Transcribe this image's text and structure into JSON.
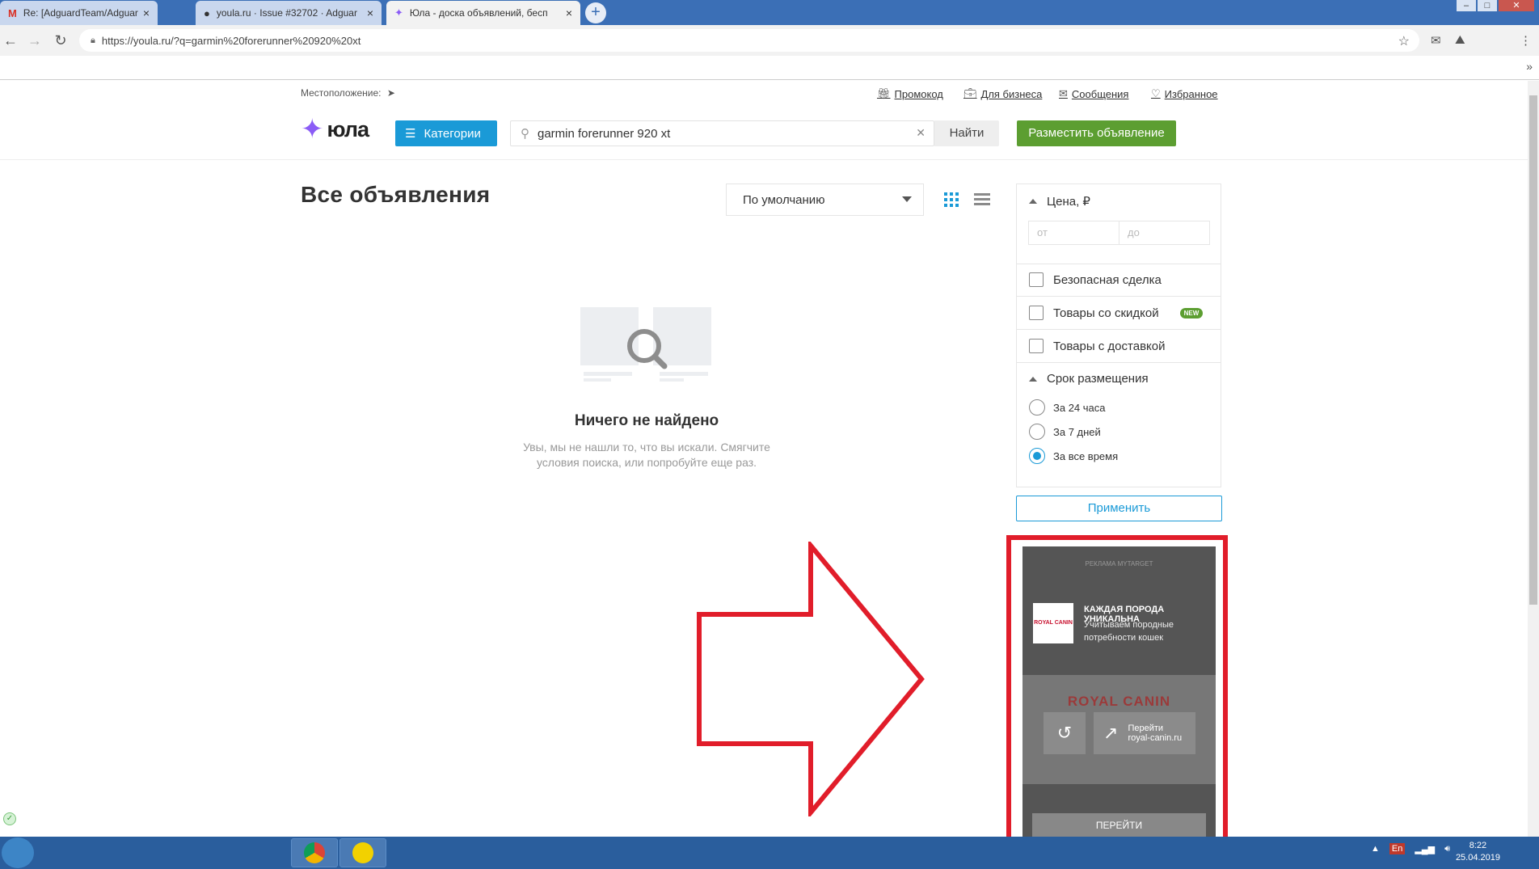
{
  "browser": {
    "tabs": [
      {
        "title": "Re: [AdguardTeam/AdguardFilte",
        "icon": "gmail-icon"
      },
      {
        "title": "youla.ru · Issue #32702 · Adguar",
        "icon": "github-icon"
      },
      {
        "title": "Юла - доска объявлений, бесп",
        "icon": "youla-icon"
      }
    ],
    "url": "https://youla.ru/?q=garmin%20forerunner%20920%20xt"
  },
  "site": {
    "location_label": "Местоположение:",
    "top_links": {
      "promo": "Промокод",
      "business": "Для бизнеса",
      "messages": "Сообщения",
      "favorites": "Избранное"
    },
    "logo_text": "юла",
    "categories_label": "Категории",
    "search_value": "garmin forerunner 920 xt",
    "find_label": "Найти",
    "post_label": "Разместить объявление"
  },
  "main": {
    "title": "Все объявления",
    "sort_value": "По умолчанию",
    "empty_title": "Ничего не найдено",
    "empty_text": "Увы, мы не нашли то, что вы искали. Смягчите условия поиска, или попробуйте еще раз."
  },
  "filters": {
    "price_title": "Цена, ₽",
    "price_from": "от",
    "price_to": "до",
    "checkboxes": [
      {
        "label": "Безопасная сделка"
      },
      {
        "label": "Товары со скидкой",
        "badge": "NEW"
      },
      {
        "label": "Товары с доставкой"
      }
    ],
    "period_title": "Срок размещения",
    "periods": [
      {
        "label": "За 24 часа",
        "selected": false
      },
      {
        "label": "За 7 дней",
        "selected": false
      },
      {
        "label": "За все время",
        "selected": true
      }
    ],
    "apply_label": "Применить"
  },
  "ad": {
    "label": "РЕКЛАМА MYTARGET",
    "logo_text": "ROYAL CANIN",
    "headline": "КАЖДАЯ ПОРОДА УНИКАЛЬНА",
    "subtext": "Учитываем породные потребности кошек",
    "image_brand": "ROYAL CANIN",
    "goto_label": "Перейти",
    "goto_domain": "royal-canin.ru",
    "cta": "ПЕРЕЙТИ"
  },
  "taskbar": {
    "lang": "En",
    "time": "8:22",
    "date": "25.04.2019"
  },
  "colors": {
    "accent_blue": "#1a9ad7",
    "accent_green": "#5c9e31",
    "highlight_red": "#e11d2a"
  }
}
